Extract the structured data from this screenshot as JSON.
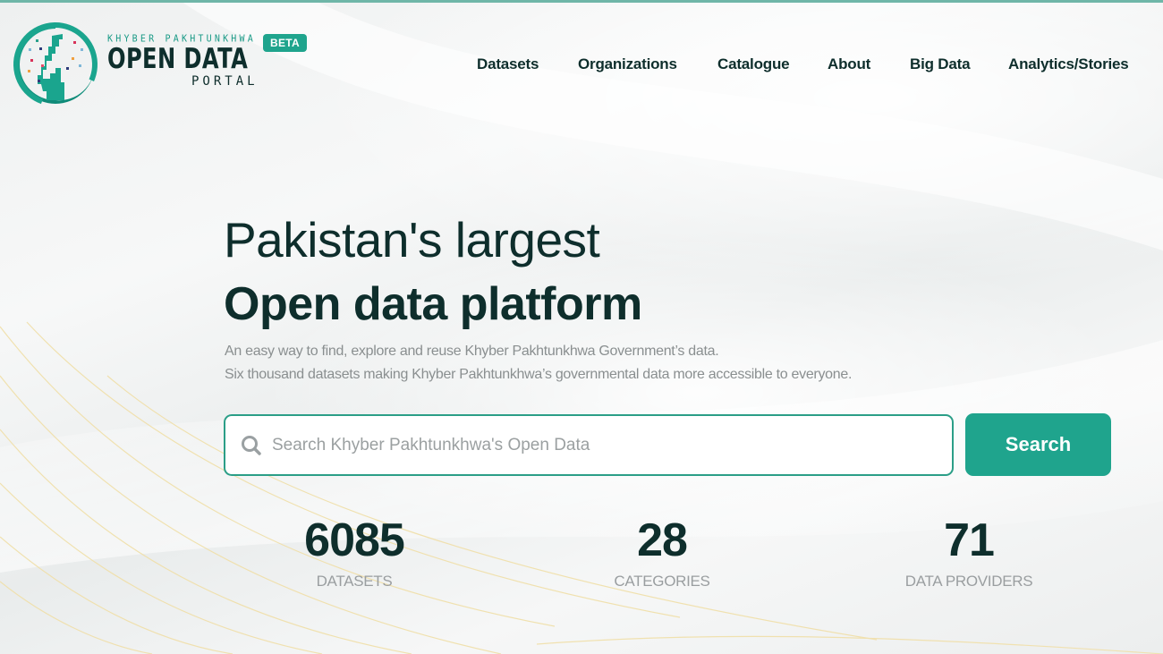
{
  "header": {
    "brand_top": "KHYBER PAKHTUNKHWA",
    "brand_main": "OPEN DATA",
    "brand_sub": "PORTAL",
    "beta_badge": "BETA",
    "logo_icon": "kp-map-circle-logo",
    "accent_color": "#1fa48d"
  },
  "nav": {
    "items": [
      {
        "label": "Datasets"
      },
      {
        "label": "Organizations"
      },
      {
        "label": "Catalogue"
      },
      {
        "label": "About"
      },
      {
        "label": "Big Data"
      },
      {
        "label": "Analytics/Stories"
      }
    ]
  },
  "hero": {
    "title_line1": "Pakistan's largest",
    "title_line2": "Open data platform",
    "subtitle_line1": "An easy way to find, explore and reuse Khyber Pakhtunkhwa Government’s data.",
    "subtitle_line2": "Six thousand datasets making Khyber Pakhtunkhwa’s governmental data more accessible to everyone."
  },
  "search": {
    "placeholder": "Search Khyber Pakhtunkhwa's Open Data",
    "value": "",
    "button_label": "Search",
    "icon": "search-icon"
  },
  "stats": [
    {
      "value": "6085",
      "label": "DATASETS"
    },
    {
      "value": "28",
      "label": "CATEGORIES"
    },
    {
      "value": "71",
      "label": "DATA PROVIDERS"
    }
  ]
}
